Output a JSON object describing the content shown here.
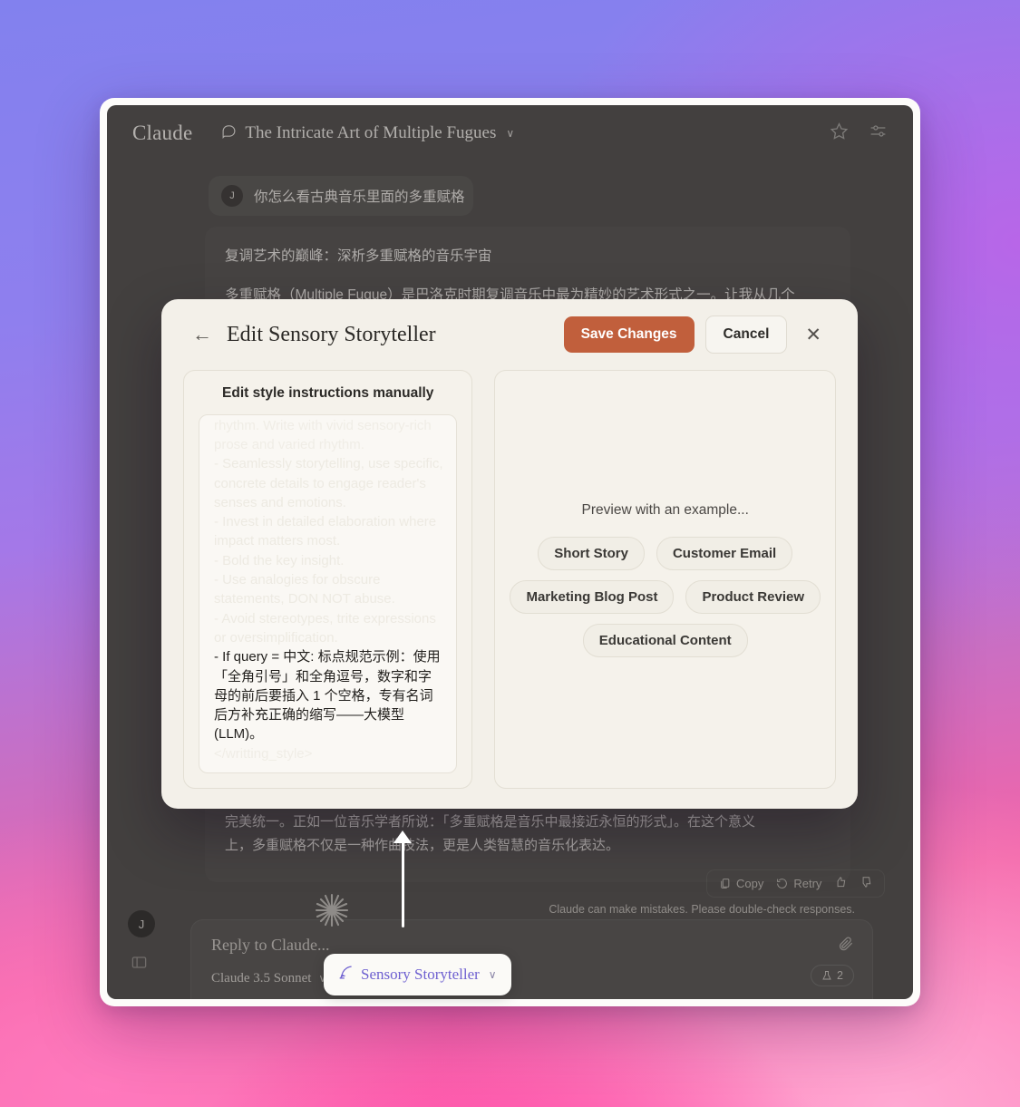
{
  "app": {
    "brand": "Claude",
    "conversation_title": "The Intricate Art of Multiple Fugues",
    "chevron": "∨",
    "header_icons": [
      "star-icon",
      "sliders-icon"
    ]
  },
  "conversation": {
    "user_avatar_initial": "J",
    "user_message": "你怎么看古典音乐里面的多重赋格",
    "assistant_heading": "复调艺术的巅峰：深析多重赋格的音乐宇宙",
    "assistant_paragraph": "多重赋格（Multiple Fugue）是巴洛克时期复调音乐中最为精妙的艺术形式之一。让我从几个",
    "tail_line_1": "完美统一。正如一位音乐学者所说：「多重赋格是音乐中最接近永恒的形式」。在这个意义",
    "tail_line_2": "上，多重赋格不仅是一种作曲技法，更是人类智慧的音乐化表达。",
    "actions": {
      "copy": "Copy",
      "retry": "Retry"
    },
    "disclaimer": "Claude can make mistakes. Please double-check responses."
  },
  "composer": {
    "placeholder": "Reply to Claude...",
    "model": "Claude 3.5 Sonnet",
    "model_chevron": "∨",
    "context_badge": "2",
    "avatar_initial": "J"
  },
  "style_pill": {
    "label": "Sensory Storyteller",
    "chevron": "∨",
    "color": "#6d5fd0"
  },
  "modal": {
    "title": "Edit Sensory Storyteller",
    "back_arrow": "←",
    "save_label": "Save Changes",
    "cancel_label": "Cancel",
    "close_glyph": "✕",
    "accent_color": "#c15f3c",
    "editor": {
      "pane_title": "Edit style instructions manually",
      "ghost_top": "rhythm. Write with vivid sensory-rich prose and varied rhythm.",
      "ghost_lines": [
        "- Seamlessly storytelling, use specific, concrete details to engage reader's senses and emotions.",
        "- Invest in detailed elaboration where impact matters most.",
        "- Bold the key insight.",
        "- Use analogies for obscure statements, DON NOT abuse.",
        "- Avoid stereotypes, trite expressions or oversimplification."
      ],
      "active_line": "- If query = 中文: 标点规范示例：使用「全角引号」和全角逗号，数字和字母的前后要插入 1 个空格，专有名词后方补充正确的缩写——大模型 (LLM)。",
      "closing_tag": "</writting_style>"
    },
    "preview": {
      "label": "Preview with an example...",
      "chips_row1": [
        "Short Story",
        "Customer Email"
      ],
      "chips_row2": [
        "Marketing Blog Post",
        "Product Review"
      ],
      "chips_row3": [
        "Educational Content"
      ]
    }
  }
}
